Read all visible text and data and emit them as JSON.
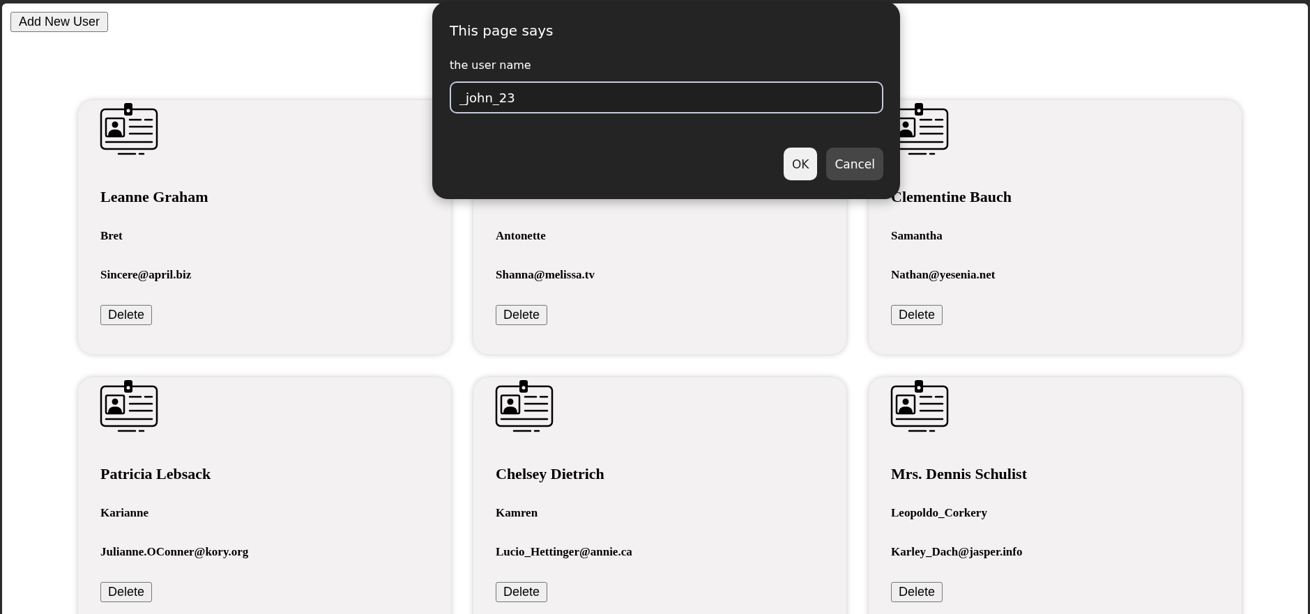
{
  "add_button": "Add New User",
  "users": [
    {
      "name": "Leanne Graham",
      "username": "Bret",
      "email": "Sincere@april.biz",
      "delete": "Delete"
    },
    {
      "username": "Antonette",
      "email": "Shanna@melissa.tv",
      "delete": "Delete"
    },
    {
      "name": "Clementine Bauch",
      "username": "Samantha",
      "email": "Nathan@yesenia.net",
      "delete": "Delete"
    },
    {
      "name": "Patricia Lebsack",
      "username": "Karianne",
      "email": "Julianne.OConner@kory.org",
      "delete": "Delete"
    },
    {
      "name": "Chelsey Dietrich",
      "username": "Kamren",
      "email": "Lucio_Hettinger@annie.ca",
      "delete": "Delete"
    },
    {
      "name": "Mrs. Dennis Schulist",
      "username": "Leopoldo_Corkery",
      "email": "Karley_Dach@jasper.info",
      "delete": "Delete"
    }
  ],
  "dialog": {
    "title": "This page says",
    "message": "the user name",
    "value": "_john_23",
    "ok": "OK",
    "cancel": "Cancel"
  }
}
